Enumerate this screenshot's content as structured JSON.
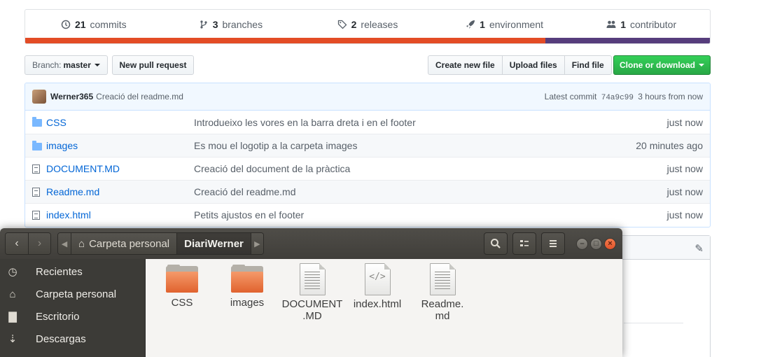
{
  "repo_summary": {
    "commits": {
      "count": "21",
      "label": "commits",
      "icon": "history-icon"
    },
    "branches": {
      "count": "3",
      "label": "branches",
      "icon": "branch-icon"
    },
    "releases": {
      "count": "2",
      "label": "releases",
      "icon": "tag-icon"
    },
    "environments": {
      "count": "1",
      "label": "environment",
      "icon": "rocket-icon"
    },
    "contributors": {
      "count": "1",
      "label": "contributor",
      "icon": "people-icon"
    },
    "language_bar": [
      {
        "color": "#e34c26",
        "fraction": 0.76
      },
      {
        "color": "#563d7c",
        "fraction": 0.24
      }
    ]
  },
  "toolbar": {
    "branch_prefix": "Branch:",
    "branch_name": "master",
    "new_pull_request": "New pull request",
    "create_new_file": "Create new file",
    "upload_files": "Upload files",
    "find_file": "Find file",
    "clone_or_download": "Clone or download",
    "accent_green": "#28a745"
  },
  "latest_commit": {
    "author": "Werner365",
    "message": "Creació del readme.md",
    "prefix": "Latest commit",
    "sha": "74a9c99",
    "age": "3 hours from now"
  },
  "files": [
    {
      "type": "folder",
      "name": "CSS",
      "message": "Introdueixo les vores en la barra dreta i en el footer",
      "age": "just now"
    },
    {
      "type": "folder",
      "name": "images",
      "message": "Es mou el logotip a la carpeta images",
      "age": "20 minutes ago"
    },
    {
      "type": "file",
      "name": "DOCUMENT.MD",
      "message": "Creació del document de la pràctica",
      "age": "just now"
    },
    {
      "type": "file",
      "name": "Readme.md",
      "message": "Creació del readme.md",
      "age": "just now"
    },
    {
      "type": "file",
      "name": "index.html",
      "message": "Petits ajustos en el footer",
      "age": "just now"
    }
  ],
  "file_manager": {
    "path": [
      "Carpeta personal",
      "DiariWerner"
    ],
    "sidebar": [
      {
        "label": "Recientes",
        "icon": "clock-icon"
      },
      {
        "label": "Carpeta personal",
        "icon": "home-icon"
      },
      {
        "label": "Escritorio",
        "icon": "desktop-folder-icon"
      },
      {
        "label": "Descargas",
        "icon": "download-icon"
      }
    ],
    "items": [
      {
        "label": "CSS",
        "kind": "folder"
      },
      {
        "label": "images",
        "kind": "folder"
      },
      {
        "label": "DOCUMENT\n.MD",
        "kind": "text"
      },
      {
        "label": "index.html",
        "kind": "html"
      },
      {
        "label": "Readme.\nmd",
        "kind": "text"
      }
    ]
  }
}
